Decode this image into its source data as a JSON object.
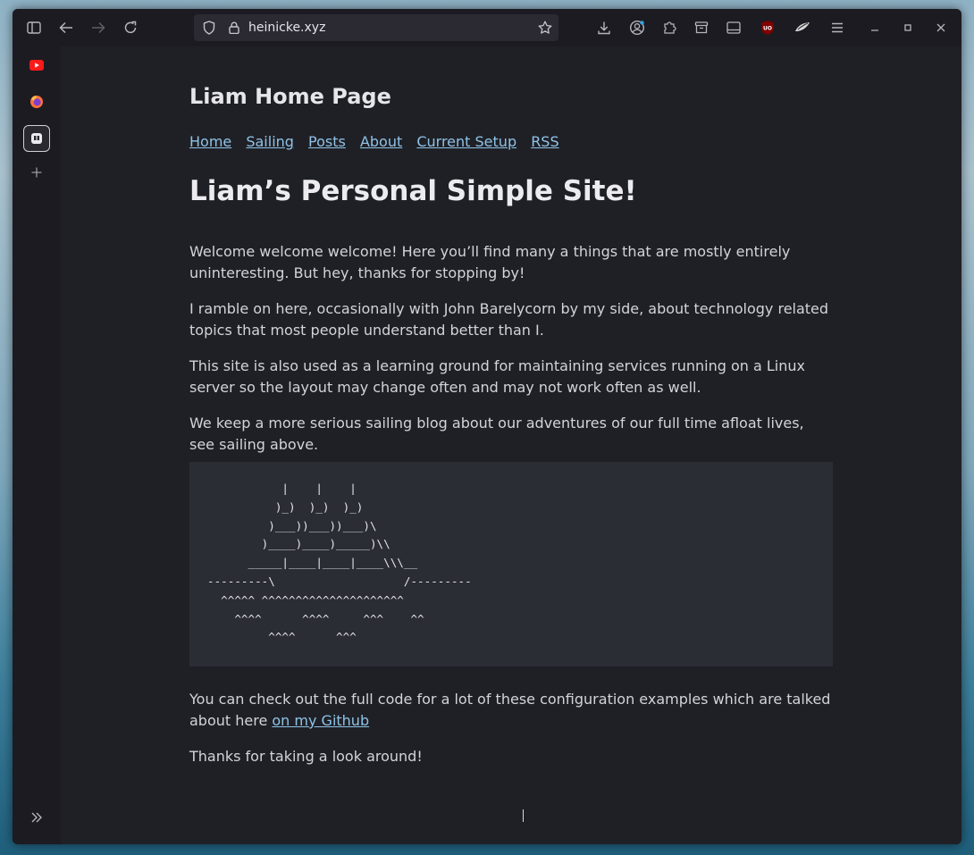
{
  "browser": {
    "url": "heinicke.xyz",
    "icons": {
      "sidebar_toggle": "sidebar-icon",
      "back": "back-arrow-icon",
      "forward": "forward-arrow-icon",
      "reload": "reload-icon",
      "downloads": "download-icon",
      "account": "account-icon",
      "extensions": "puzzle-icon",
      "pocket": "archive-icon",
      "reader": "reader-view-icon",
      "ublock": "ublock-origin-icon",
      "menu": "hamburger-menu-icon"
    },
    "ublock_label": "UO"
  },
  "sidebar": {
    "items": [
      {
        "name": "YouTube",
        "icon": "youtube-icon"
      },
      {
        "name": "Firefox",
        "icon": "firefox-icon"
      },
      {
        "name": "Active extension",
        "icon": "app-icon"
      }
    ]
  },
  "page": {
    "site_title": "Liam Home Page",
    "nav": [
      "Home",
      "Sailing",
      "Posts",
      "About",
      "Current Setup",
      "RSS"
    ],
    "headline": "Liam’s Personal Simple Site!",
    "paragraphs": [
      "Welcome welcome welcome! Here you’ll find many a things that are mostly entirely uninteresting. But hey, thanks for stopping by!",
      "I ramble on here, occasionally with John Barelycorn by my side, about technology related topics that most people understand better than I.",
      "This site is also used as a learning ground for maintaining services running on a Linux server so the layout may change often and may not work often as well.",
      "We keep a more serious sailing blog about our adventures of our full time afloat lives, see sailing above."
    ],
    "ascii_art": "           |    |    |\n          )_)  )_)  )_)\n         )___))___))___)\\\n        )____)____)_____)\\\\\n      _____|____|____|____\\\\\\__\n---------\\                   /---------\n  ^^^^^ ^^^^^^^^^^^^^^^^^^^^^\n    ^^^^      ^^^^     ^^^    ^^\n         ^^^^      ^^^",
    "github_text": "You can check out the full code for a lot of these configuration examples which are talked about here ",
    "github_link": "on my Github",
    "closing": "Thanks for taking a look around!"
  }
}
